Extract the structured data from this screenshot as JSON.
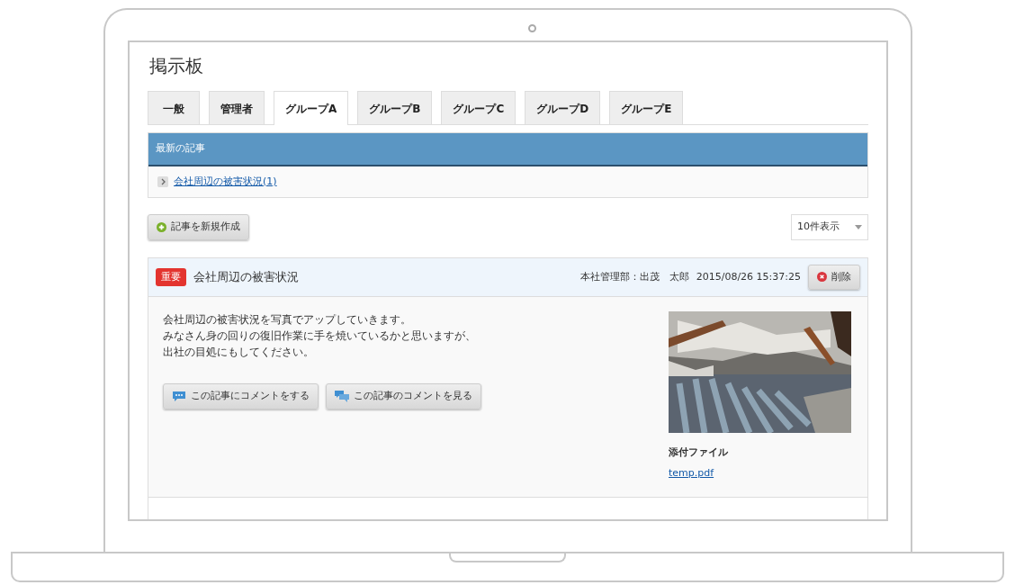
{
  "title": "掲示板",
  "tabs": [
    {
      "label": "一般",
      "selected": false
    },
    {
      "label": "管理者",
      "selected": false
    },
    {
      "label": "グループA",
      "selected": true
    },
    {
      "label": "グループB",
      "selected": false
    },
    {
      "label": "グループC",
      "selected": false
    },
    {
      "label": "グループD",
      "selected": false
    },
    {
      "label": "グループE",
      "selected": false
    }
  ],
  "latest": {
    "heading": "最新の記事",
    "items": [
      {
        "label": "会社周辺の被害状況(1)"
      }
    ]
  },
  "new_button": "記事を新規作成",
  "page_size": {
    "value": "10件表示"
  },
  "posts": [
    {
      "badge": "重要",
      "title": "会社周辺の被害状況",
      "author": "本社管理部：出茂　太郎",
      "date": "2015/08/26 15:37:25",
      "delete_button": "削除",
      "body": [
        "会社周辺の被害状況を写真でアップしていきます。",
        "みなさん身の回りの復旧作業に手を焼いているかと思いますが、",
        "出社の目処にもしてください。"
      ],
      "buttons": [
        "この記事にコメントをする",
        "この記事のコメントを見る"
      ],
      "attachment_label": "添付ファイル",
      "attachment": "temp.pdf"
    }
  ]
}
